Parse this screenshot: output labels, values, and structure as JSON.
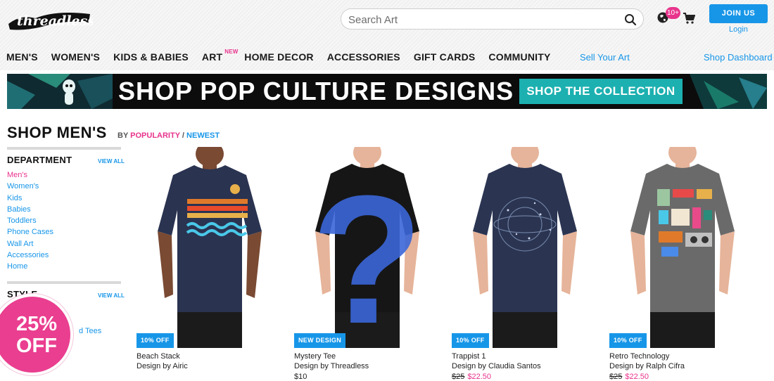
{
  "brand": {
    "logo_text": "threadless"
  },
  "search": {
    "placeholder": "Search Art"
  },
  "header": {
    "notification_badge": "10+",
    "join_label": "JOIN US",
    "login_label": "Login"
  },
  "nav": {
    "items": [
      "MEN'S",
      "WOMEN'S",
      "KIDS & BABIES",
      "ART",
      "HOME DECOR",
      "ACCESSORIES",
      "GIFT CARDS",
      "COMMUNITY"
    ],
    "art_new": "NEW",
    "sell_link": "Sell Your Art",
    "dashboard_link": "Shop Dashboard"
  },
  "banner": {
    "title": "SHOP POP CULTURE DESIGNS",
    "cta": "SHOP THE COLLECTION"
  },
  "page": {
    "title": "SHOP MEN'S",
    "sort_by": "BY",
    "sort_popularity": "POPULARITY",
    "sort_sep": "/",
    "sort_newest": "NEWEST"
  },
  "sidebar": {
    "department_title": "DEPARTMENT",
    "view_all": "VIEW ALL",
    "departments": [
      "Men's",
      "Women's",
      "Kids",
      "Babies",
      "Toddlers",
      "Phone Cases",
      "Wall Art",
      "Accessories",
      "Home"
    ],
    "style_title": "STYLE",
    "style_item": "d Tees"
  },
  "promo": {
    "line1": "25%",
    "line2": "OFF"
  },
  "products": [
    {
      "tag": "10% OFF",
      "title": "Beach Stack",
      "designer": "Design by Airic",
      "price": "",
      "old_price": "",
      "sale_price": ""
    },
    {
      "tag": "NEW DESIGN",
      "title": "Mystery Tee",
      "designer": "Design by Threadless",
      "price": "$10",
      "old_price": "",
      "sale_price": ""
    },
    {
      "tag": "10% OFF",
      "title": "Trappist 1",
      "designer": "Design by Claudia Santos",
      "price": "",
      "old_price": "$25",
      "sale_price": "$22.50"
    },
    {
      "tag": "10% OFF",
      "title": "Retro Technology",
      "designer": "Design by Ralph Cifra",
      "price": "",
      "old_price": "$25",
      "sale_price": "$22.50"
    }
  ],
  "colors": {
    "accent_blue": "#1796e8",
    "accent_pink": "#e8338c",
    "banner_cta": "#1cb0b0",
    "shirt_navy": "#2a3350",
    "shirt_black": "#161616",
    "shirt_grey": "#6a6a6a"
  }
}
